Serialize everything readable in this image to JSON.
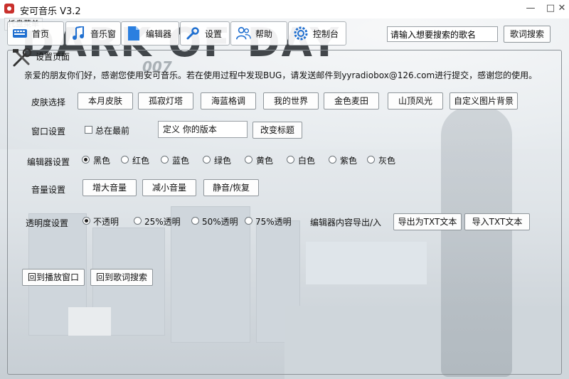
{
  "window": {
    "title": "安可音乐 V3.2"
  },
  "tray": {
    "label": "托盘菜单"
  },
  "background": {
    "logo_text": "DARK OF DAY",
    "logo_sub": "007"
  },
  "nav": [
    {
      "label": "首页",
      "icon": "keyboard-icon"
    },
    {
      "label": "音乐窗",
      "icon": "music-note-icon"
    },
    {
      "label": "编辑器",
      "icon": "document-icon"
    },
    {
      "label": "设置",
      "icon": "wrench-icon"
    },
    {
      "label": "帮助",
      "icon": "people-icon"
    },
    {
      "label": "控制台",
      "icon": "gear-icon"
    }
  ],
  "search": {
    "value": "请输入想要搜索的歌名",
    "button": "歌词搜索"
  },
  "settings": {
    "group_title": "设置页面",
    "intro": "亲爱的朋友你们好，感谢您使用安可音乐。若在使用过程中发现BUG，请发送邮件到yyradiobox@126.com进行提交，感谢您的使用。",
    "skin": {
      "label": "皮肤选择",
      "options": [
        "本月皮肤",
        "孤寂灯塔",
        "海蓝格调",
        "我的世界",
        "金色麦田",
        "山顶风光",
        "自定义图片背景"
      ]
    },
    "window": {
      "label": "窗口设置",
      "always_on_top": "总在最前",
      "version_field": "定义 你的版本",
      "change_title": "改变标题"
    },
    "editor": {
      "label": "编辑器设置",
      "colors": [
        "黑色",
        "红色",
        "蓝色",
        "绿色",
        "黄色",
        "白色",
        "紫色",
        "灰色"
      ],
      "selected": "黑色"
    },
    "volume": {
      "label": "音量设置",
      "up": "增大音量",
      "down": "减小音量",
      "mute": "静音/恢复"
    },
    "opacity": {
      "label": "透明度设置",
      "options": [
        "不透明",
        "25%透明",
        "50%透明",
        "75%透明"
      ],
      "selected": "不透明"
    },
    "export": {
      "label": "编辑器内容导出/入",
      "export_txt": "导出为TXT文本",
      "import_txt": "导入TXT文本"
    },
    "back_player": "回到播放窗口",
    "back_lyrics": "回到歌词搜索"
  }
}
